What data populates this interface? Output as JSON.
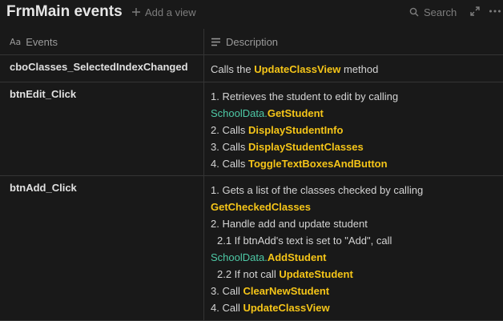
{
  "page": {
    "title": "FrmMain events",
    "add_view_label": "Add a view",
    "search_label": "Search"
  },
  "columns": {
    "events": "Events",
    "description": "Description"
  },
  "rows": [
    {
      "event": "cboClasses_SelectedIndexChanged",
      "lines": [
        [
          "Calls the ",
          "UpdateClassView",
          " method"
        ]
      ]
    },
    {
      "event": "btnEdit_Click",
      "lines": [
        [
          "1. Retrieves the student to edit by calling"
        ],
        [
          "SchoolData.",
          "GetStudent"
        ],
        [
          "2. Calls ",
          "DisplayStudentInfo"
        ],
        [
          "3. Calls ",
          "DisplayStudentClasses"
        ],
        [
          "4. Calls ",
          "ToggleTextBoxesAndButton"
        ]
      ]
    },
    {
      "event": "btnAdd_Click",
      "lines": [
        [
          "1. Gets a list of the classes checked by calling"
        ],
        [
          "GetCheckedClasses"
        ],
        [
          "2. Handle add and update student"
        ],
        [
          "2.1 If btnAdd's text is set to \"Add\", call"
        ],
        [
          "SchoolData.",
          "AddStudent"
        ],
        [
          "2.2 If not call ",
          "UpdateStudent"
        ],
        [
          "3. Call ",
          "ClearNewStudent"
        ],
        [
          "4. Call ",
          "UpdateClassView"
        ]
      ]
    }
  ]
}
